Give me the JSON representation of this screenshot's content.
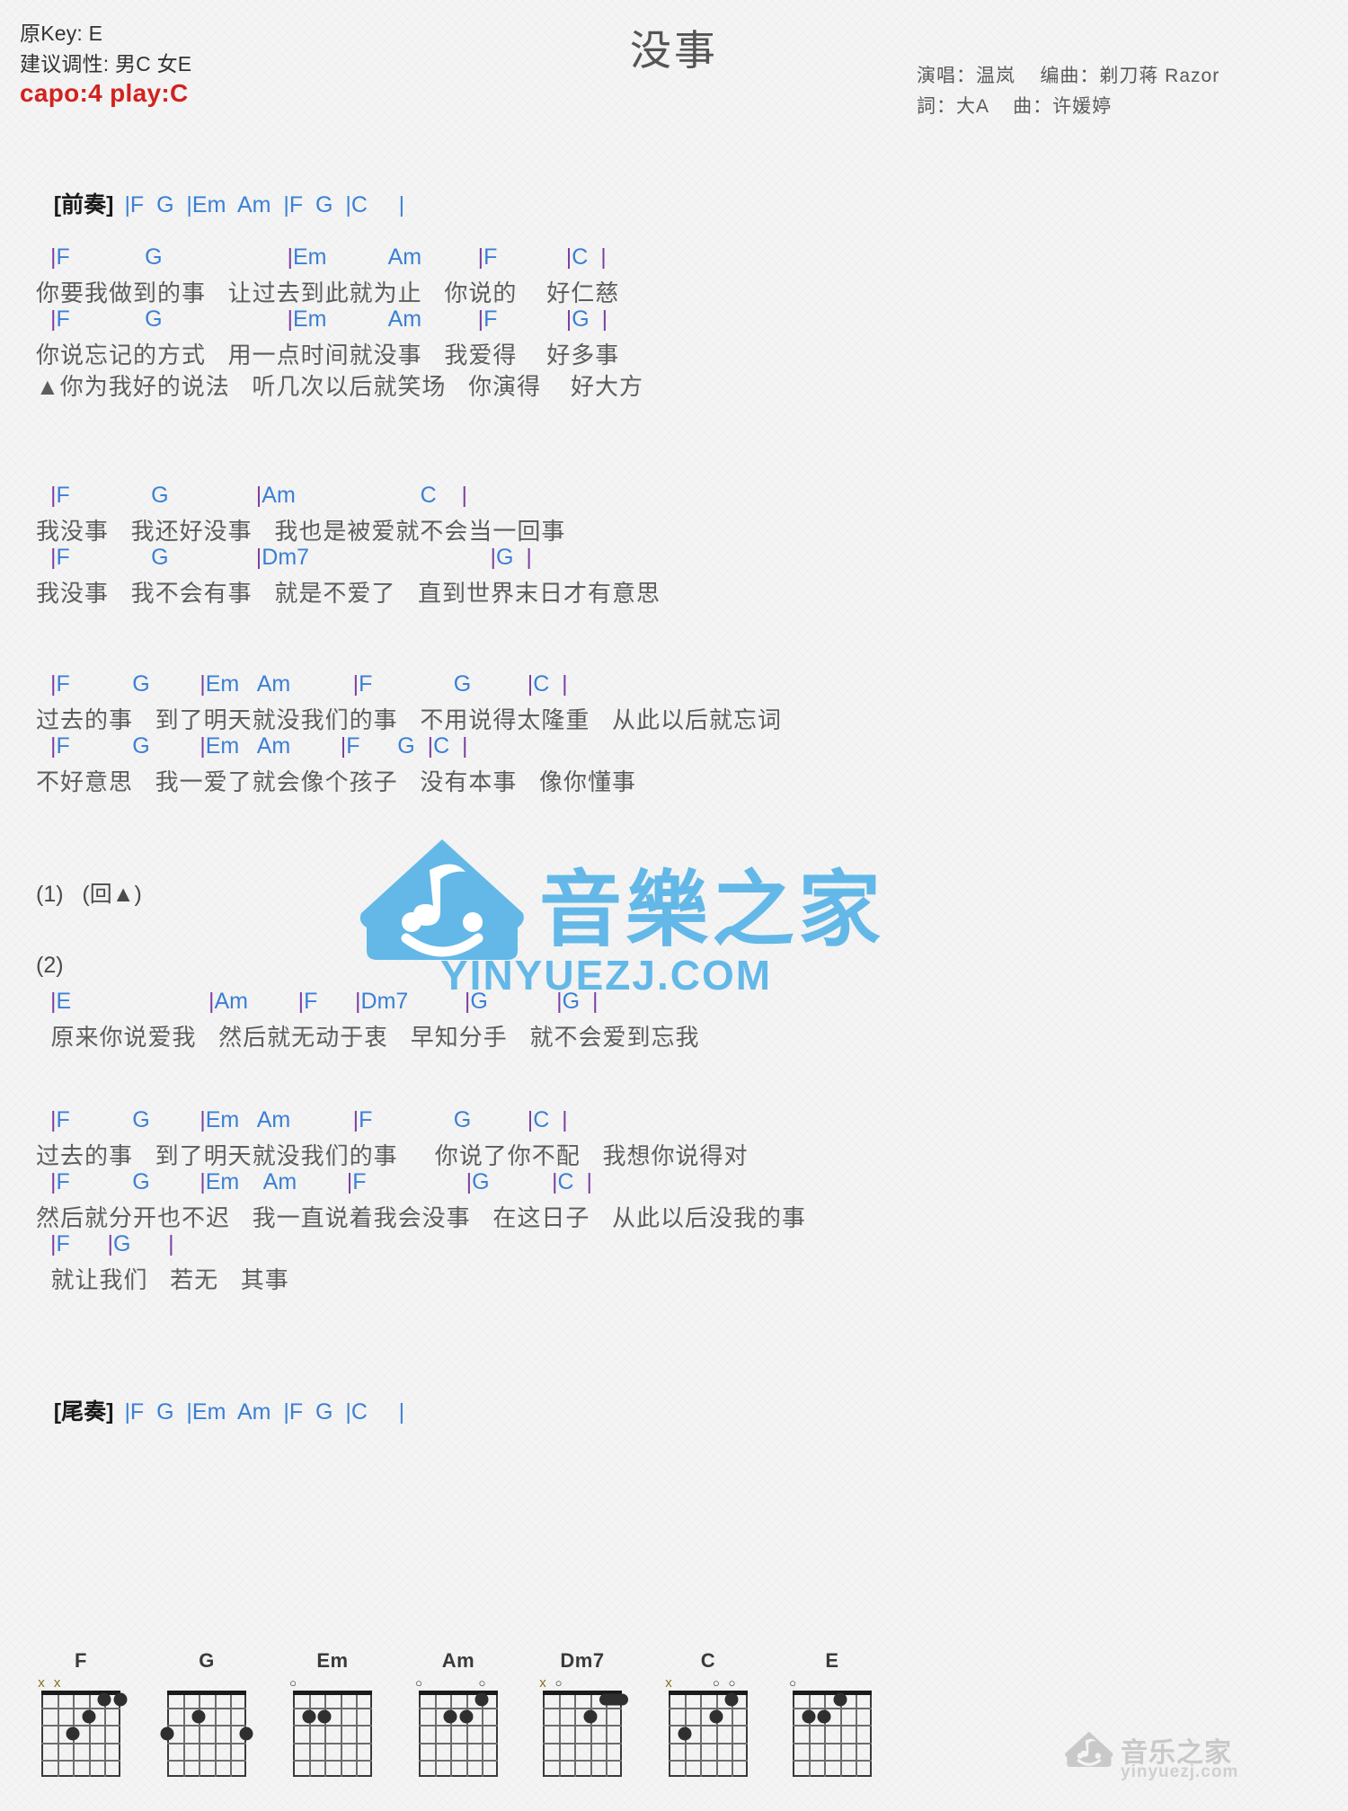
{
  "header": {
    "original_key_label": "原Key: E",
    "suggested_key_label": "建议调性: 男C 女E",
    "capo_label": "capo:4 play:C",
    "capo_color": "#d2221e",
    "title": "没事",
    "credit_line1": "演唱：温岚    编曲：剃刀蒋 Razor",
    "credit_line2": "詞：大A    曲：许媛婷"
  },
  "colors": {
    "chord": "#3b7fd4",
    "barline": "#7c3fa0",
    "lyric": "#5d5d5d",
    "watermark": "#63b8e8"
  },
  "intro": {
    "tag": "[前奏]",
    "chords": "|F  G  |Em  Am  |F  G  |C     |"
  },
  "outro": {
    "tag": "[尾奏]",
    "chords": "|F  G  |Em  Am  |F  G  |C     |"
  },
  "sections": [
    {
      "name": "verse-1",
      "lines": [
        {
          "type": "chord",
          "text": "|F            G                    |Em          Am         |F           |C  |"
        },
        {
          "type": "lyric",
          "text": "你要我做到的事   让过去到此就为止   你说的    好仁慈"
        },
        {
          "type": "chord",
          "text": "|F            G                    |Em          Am         |F           |G  |"
        },
        {
          "type": "lyric",
          "text": "你说忘记的方式   用一点时间就没事   我爱得    好多事"
        },
        {
          "type": "lyric",
          "text": "▲你为我好的说法   听几次以后就笑场   你演得    好大方"
        }
      ]
    },
    {
      "name": "chorus-1",
      "lines": [
        {
          "type": "chord",
          "text": "|F             G              |Am                    C    |"
        },
        {
          "type": "lyric",
          "text": "我没事   我还好没事   我也是被爱就不会当一回事"
        },
        {
          "type": "chord",
          "text": "|F             G              |Dm7                             |G  |"
        },
        {
          "type": "lyric",
          "text": "我没事   我不会有事   就是不爱了   直到世界末日才有意思"
        }
      ]
    },
    {
      "name": "chorus-2",
      "lines": [
        {
          "type": "chord",
          "text": "|F          G        |Em   Am          |F             G         |C  |"
        },
        {
          "type": "lyric",
          "text": "过去的事   到了明天就没我们的事   不用说得太隆重   从此以后就忘词"
        },
        {
          "type": "chord",
          "text": "|F          G        |Em   Am        |F      G  |C  |"
        },
        {
          "type": "lyric",
          "text": "不好意思   我一爱了就会像个孩子   没有本事   像你懂事"
        }
      ]
    },
    {
      "name": "repeat-marker-1",
      "lines": [
        {
          "type": "marker",
          "text": "(1)   (回▲)"
        }
      ]
    },
    {
      "name": "bridge-2",
      "lines": [
        {
          "type": "marker",
          "text": "(2)"
        },
        {
          "type": "chord",
          "text": "|E                      |Am        |F      |Dm7         |G           |G  |"
        },
        {
          "type": "lyric",
          "text": "  原来你说爱我   然后就无动于衷   早知分手   就不会爱到忘我"
        }
      ]
    },
    {
      "name": "chorus-3",
      "lines": [
        {
          "type": "chord",
          "text": "|F          G        |Em   Am          |F             G         |C  |"
        },
        {
          "type": "lyric",
          "text": "过去的事   到了明天就没我们的事     你说了你不配   我想你说得对"
        },
        {
          "type": "chord",
          "text": "|F          G        |Em    Am        |F                |G          |C  |"
        },
        {
          "type": "lyric",
          "text": "然后就分开也不迟   我一直说着我会没事   在这日子   从此以后没我的事"
        },
        {
          "type": "chord",
          "text": "|F      |G      |"
        },
        {
          "type": "lyric",
          "text": "  就让我们   若无   其事"
        }
      ]
    }
  ],
  "watermark": {
    "brand_cn": "音樂之家",
    "brand_url": "YINYUEZJ.COM",
    "footer_cn": "音乐之家",
    "footer_url": "yinyuezj.com"
  },
  "chord_diagrams": [
    {
      "name": "F",
      "marks": [
        {
          "symbol": "x",
          "string": 1
        },
        {
          "symbol": "x",
          "string": 2
        }
      ],
      "dots": [
        {
          "string": 5,
          "fret": 1
        },
        {
          "string": 6,
          "fret": 1
        },
        {
          "string": 4,
          "fret": 2
        },
        {
          "string": 3,
          "fret": 3
        }
      ],
      "barre": null
    },
    {
      "name": "G",
      "marks": [],
      "dots": [
        {
          "string": 3,
          "fret": 2
        },
        {
          "string": 1,
          "fret": 3
        },
        {
          "string": 6,
          "fret": 3
        }
      ],
      "barre": null
    },
    {
      "name": "Em",
      "marks": [
        {
          "symbol": "o",
          "string": 1
        }
      ],
      "dots": [
        {
          "string": 2,
          "fret": 2
        },
        {
          "string": 3,
          "fret": 2
        }
      ],
      "barre": null
    },
    {
      "name": "Am",
      "marks": [
        {
          "symbol": "o",
          "string": 1
        },
        {
          "symbol": "o",
          "string": 5
        }
      ],
      "dots": [
        {
          "string": 5,
          "fret": 1
        },
        {
          "string": 3,
          "fret": 2
        },
        {
          "string": 4,
          "fret": 2
        }
      ],
      "barre": null
    },
    {
      "name": "Dm7",
      "marks": [
        {
          "symbol": "x",
          "string": 1
        },
        {
          "symbol": "o",
          "string": 2
        }
      ],
      "dots": [
        {
          "string": 4,
          "fret": 2
        }
      ],
      "barre": {
        "fret": 1,
        "from": 5,
        "to": 6
      }
    },
    {
      "name": "C",
      "marks": [
        {
          "symbol": "x",
          "string": 1
        },
        {
          "symbol": "o",
          "string": 4
        },
        {
          "symbol": "o",
          "string": 5
        }
      ],
      "dots": [
        {
          "string": 5,
          "fret": 1
        },
        {
          "string": 4,
          "fret": 2
        },
        {
          "string": 2,
          "fret": 3
        }
      ],
      "barre": null
    },
    {
      "name": "E",
      "marks": [
        {
          "symbol": "o",
          "string": 1
        }
      ],
      "dots": [
        {
          "string": 4,
          "fret": 1
        },
        {
          "string": 3,
          "fret": 2
        },
        {
          "string": 2,
          "fret": 2
        }
      ],
      "barre": null
    }
  ]
}
